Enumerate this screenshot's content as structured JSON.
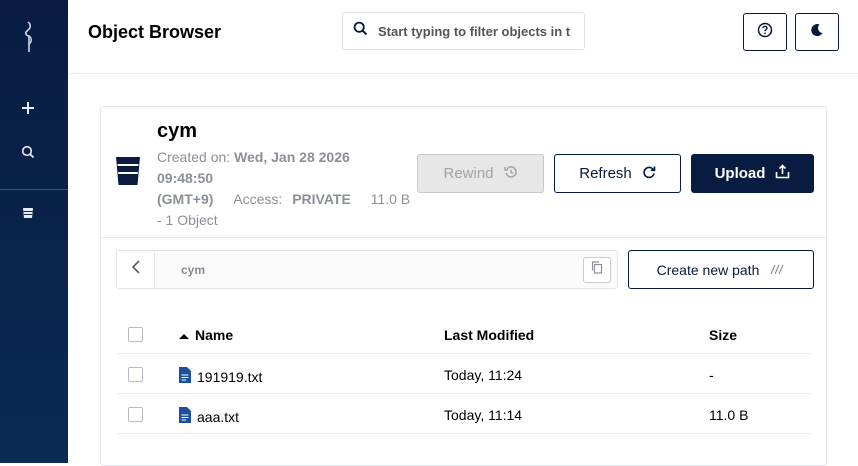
{
  "header": {
    "title": "Object Browser",
    "search_placeholder": "Start typing to filter objects in t",
    "help_icon": "help-circle-icon",
    "theme_icon": "moon-icon"
  },
  "sidebar": {
    "logo_icon": "minio-bird-logo",
    "items": [
      {
        "icon": "plus-icon"
      },
      {
        "icon": "search-icon"
      },
      {
        "icon": "bucket-icon"
      }
    ]
  },
  "bucket": {
    "name": "cym",
    "created_label": "Created on:",
    "created_value_l1": "Wed, Jan 28 2026",
    "created_value_l2": "09:48:50",
    "created_value_l3": "(GMT+9)",
    "access_label": "Access:",
    "access_value": "PRIVATE",
    "size": "11.0 B",
    "objects": "- 1 Object"
  },
  "actions": {
    "rewind": "Rewind",
    "refresh": "Refresh",
    "upload": "Upload",
    "create_path": "Create new path"
  },
  "breadcrumb": {
    "path": "cym"
  },
  "table": {
    "columns": {
      "name": "Name",
      "modified": "Last Modified",
      "size": "Size"
    },
    "rows": [
      {
        "name": "191919.txt",
        "modified": "Today, 11:24",
        "size": "-"
      },
      {
        "name": "aaa.txt",
        "modified": "Today, 11:14",
        "size": "11.0 B"
      }
    ]
  },
  "colors": {
    "sidebar": "#081c42",
    "primary": "#081c42",
    "disabled": "#e7e7e7"
  }
}
